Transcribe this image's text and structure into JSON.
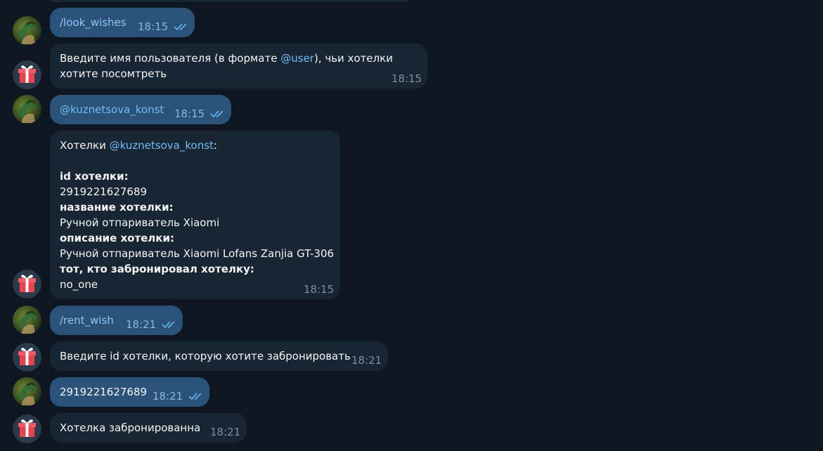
{
  "chat": {
    "messages": [
      {
        "id": "m1",
        "direction": "out",
        "text": "/look_wishes",
        "time": "18:15",
        "read": true
      },
      {
        "id": "m2",
        "direction": "in",
        "text_parts": [
          "Введите имя пользователя (в формате ",
          "@user",
          "), чьи хотелки",
          "хотите посомтреть"
        ],
        "time": "18:15"
      },
      {
        "id": "m3",
        "direction": "out",
        "text": "@kuznetsova_konst",
        "time": "18:15",
        "read": true
      },
      {
        "id": "m4",
        "direction": "in",
        "header_prefix": "Хотелки ",
        "header_mention": "@kuznetsova_konst",
        "header_suffix": ":",
        "fields": [
          {
            "label": "id хотелки:",
            "value": "2919221627689"
          },
          {
            "label": "название хотелки:",
            "value": "Ручной отпариватель Xiaomi"
          },
          {
            "label": "описание хотелки:",
            "value": "Ручной отпариватель Xiaomi Lofans Zanjia GT-306"
          },
          {
            "label": "тот, кто забронировал хотелку:",
            "value": "no_one"
          }
        ],
        "time": "18:15"
      },
      {
        "id": "m5",
        "direction": "out",
        "text": "/rent_wish",
        "time": "18:21",
        "read": true
      },
      {
        "id": "m6",
        "direction": "in",
        "text": "Введите id хотелки, которую хотите забронировать",
        "time": "18:21"
      },
      {
        "id": "m7",
        "direction": "out",
        "text": "2919221627689",
        "time": "18:21",
        "read": true
      },
      {
        "id": "m8",
        "direction": "in",
        "text": "Хотелка забронированна",
        "time": "18:21"
      }
    ]
  },
  "colors": {
    "background": "#0e1621",
    "outgoing_bubble": "#2b5278",
    "incoming_bubble": "#182533",
    "link": "#71baf5",
    "check": "#5fb0f0"
  },
  "icons": {
    "user_avatar": "user-avatar-photo",
    "bot_avatar": "gift-icon",
    "read_receipt": "double-check-icon"
  }
}
